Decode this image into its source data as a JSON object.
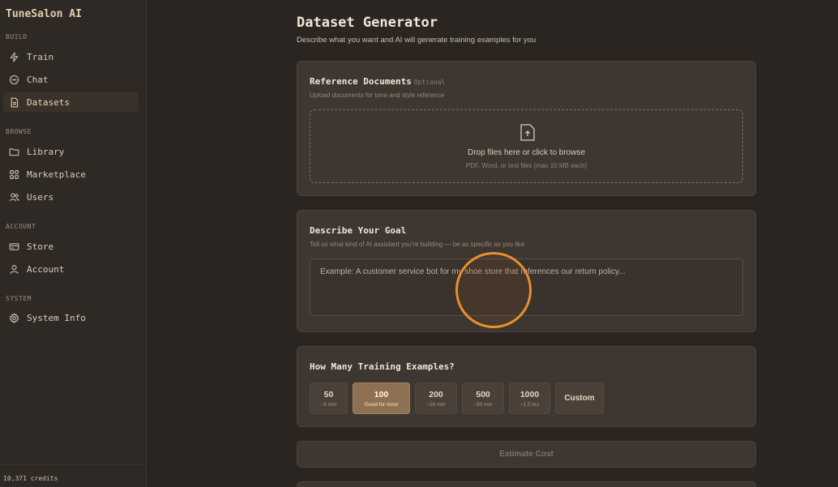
{
  "app": {
    "title": "TuneSalon AI"
  },
  "sidebar": {
    "sections": [
      {
        "label": "BUILD"
      },
      {
        "label": "BROWSE"
      },
      {
        "label": "ACCOUNT"
      },
      {
        "label": "SYSTEM"
      }
    ],
    "items": [
      {
        "label": "Train",
        "icon": "bolt-icon"
      },
      {
        "label": "Chat",
        "icon": "chat-bubble-icon"
      },
      {
        "label": "Datasets",
        "icon": "document-icon",
        "active": true
      },
      {
        "label": "Library",
        "icon": "folder-icon"
      },
      {
        "label": "Marketplace",
        "icon": "grid-icon"
      },
      {
        "label": "Users",
        "icon": "users-icon"
      },
      {
        "label": "Store",
        "icon": "credit-card-icon"
      },
      {
        "label": "Account",
        "icon": "user-icon"
      },
      {
        "label": "System Info",
        "icon": "gear-icon"
      }
    ],
    "credits": "10,371 credits"
  },
  "page": {
    "title": "Dataset Generator",
    "subtitle": "Describe what you want and AI will generate training examples for you"
  },
  "reference": {
    "title": "Reference Documents",
    "optional": "Optional",
    "subtitle": "Upload documents for tone and style reference",
    "drop_main": "Drop files here or click to browse",
    "drop_sub": "PDF, Word, or text files (max 10 MB each)"
  },
  "goal": {
    "title": "Describe Your Goal",
    "subtitle": "Tell us what kind of AI assistant you're building — be as specific as you like",
    "placeholder": "Example: A customer service bot for my shoe store that references our return policy..."
  },
  "examples": {
    "title": "How Many Training Examples?",
    "options": [
      {
        "value": "50",
        "sub": "~5 min"
      },
      {
        "value": "100",
        "sub": "Good for most",
        "selected": true
      },
      {
        "value": "200",
        "sub": "~20 min"
      },
      {
        "value": "500",
        "sub": "~50 min"
      },
      {
        "value": "1000",
        "sub": "~1.5 hrs"
      }
    ],
    "custom": "Custom"
  },
  "actions": {
    "estimate": "Estimate Cost"
  },
  "colors": {
    "accent": "#8e7152",
    "cursor": "#e8902f",
    "background": "#2b2521"
  }
}
